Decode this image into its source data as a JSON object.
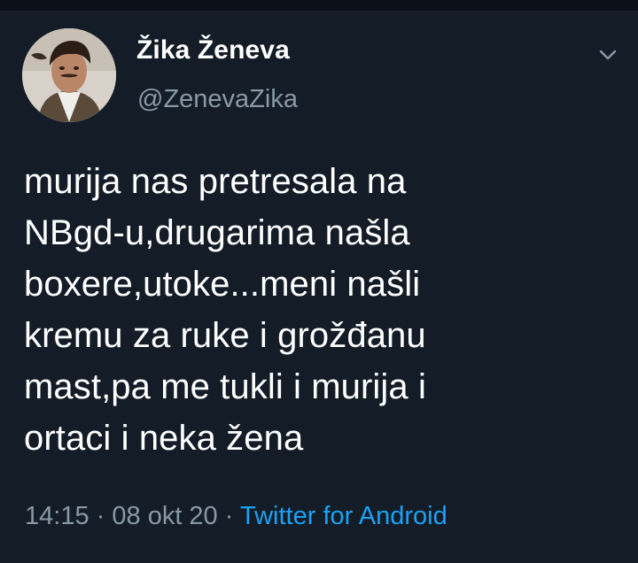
{
  "tweet": {
    "author": {
      "display_name": "Žika Ženeva",
      "handle": "@ZenevaZika"
    },
    "text_lines": [
      "murija nas pretresala na",
      "NBgd-u,drugarima našla",
      "boxere,utoke...meni našli",
      "kremu za ruke i grožđanu",
      "mast,pa me tukli i murija i",
      "ortaci i neka žena"
    ],
    "meta": {
      "time": "14:15",
      "separator": "·",
      "date": "08 okt 20",
      "source": "Twitter for Android"
    }
  },
  "icons": {
    "caret": "chevron-down-icon",
    "avatar": "profile-photo"
  },
  "colors": {
    "background": "#141d27",
    "text": "#ffffff",
    "muted": "#8899a6",
    "link": "#1da1f2"
  }
}
